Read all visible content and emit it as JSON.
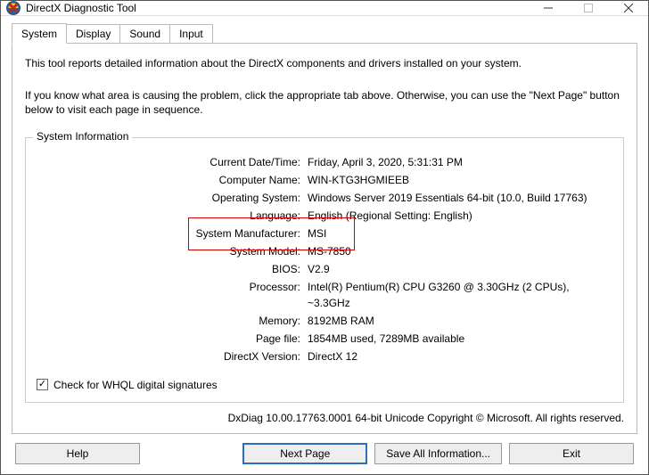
{
  "window": {
    "title": "DirectX Diagnostic Tool"
  },
  "tabs": {
    "system": "System",
    "display": "Display",
    "sound": "Sound",
    "input": "Input"
  },
  "intro": {
    "line1": "This tool reports detailed information about the DirectX components and drivers installed on your system.",
    "line2": "If you know what area is causing the problem, click the appropriate tab above.  Otherwise, you can use the \"Next Page\" button below to visit each page in sequence."
  },
  "group": {
    "title": "System Information"
  },
  "info": {
    "date_label": "Current Date/Time:",
    "date_value": "Friday, April 3, 2020, 5:31:31 PM",
    "computer_label": "Computer Name:",
    "computer_value": "WIN-KTG3HGMIEEB",
    "os_label": "Operating System:",
    "os_value": "Windows Server 2019 Essentials 64-bit (10.0, Build 17763)",
    "lang_label": "Language:",
    "lang_value": "English (Regional Setting: English)",
    "manu_label": "System Manufacturer:",
    "manu_value": "MSI",
    "model_label": "System Model:",
    "model_value": "MS-7850",
    "bios_label": "BIOS:",
    "bios_value": "V2.9",
    "proc_label": "Processor:",
    "proc_value": "Intel(R) Pentium(R) CPU G3260 @ 3.30GHz (2 CPUs), ~3.3GHz",
    "mem_label": "Memory:",
    "mem_value": "8192MB RAM",
    "page_label": "Page file:",
    "page_value": "1854MB used, 7289MB available",
    "dx_label": "DirectX Version:",
    "dx_value": "DirectX 12"
  },
  "checkbox": {
    "label": "Check for WHQL digital signatures",
    "checked_glyph": "✓"
  },
  "footer": "DxDiag 10.00.17763.0001 64-bit Unicode   Copyright © Microsoft. All rights reserved.",
  "buttons": {
    "help": "Help",
    "next": "Next Page",
    "save": "Save All Information...",
    "exit": "Exit"
  }
}
